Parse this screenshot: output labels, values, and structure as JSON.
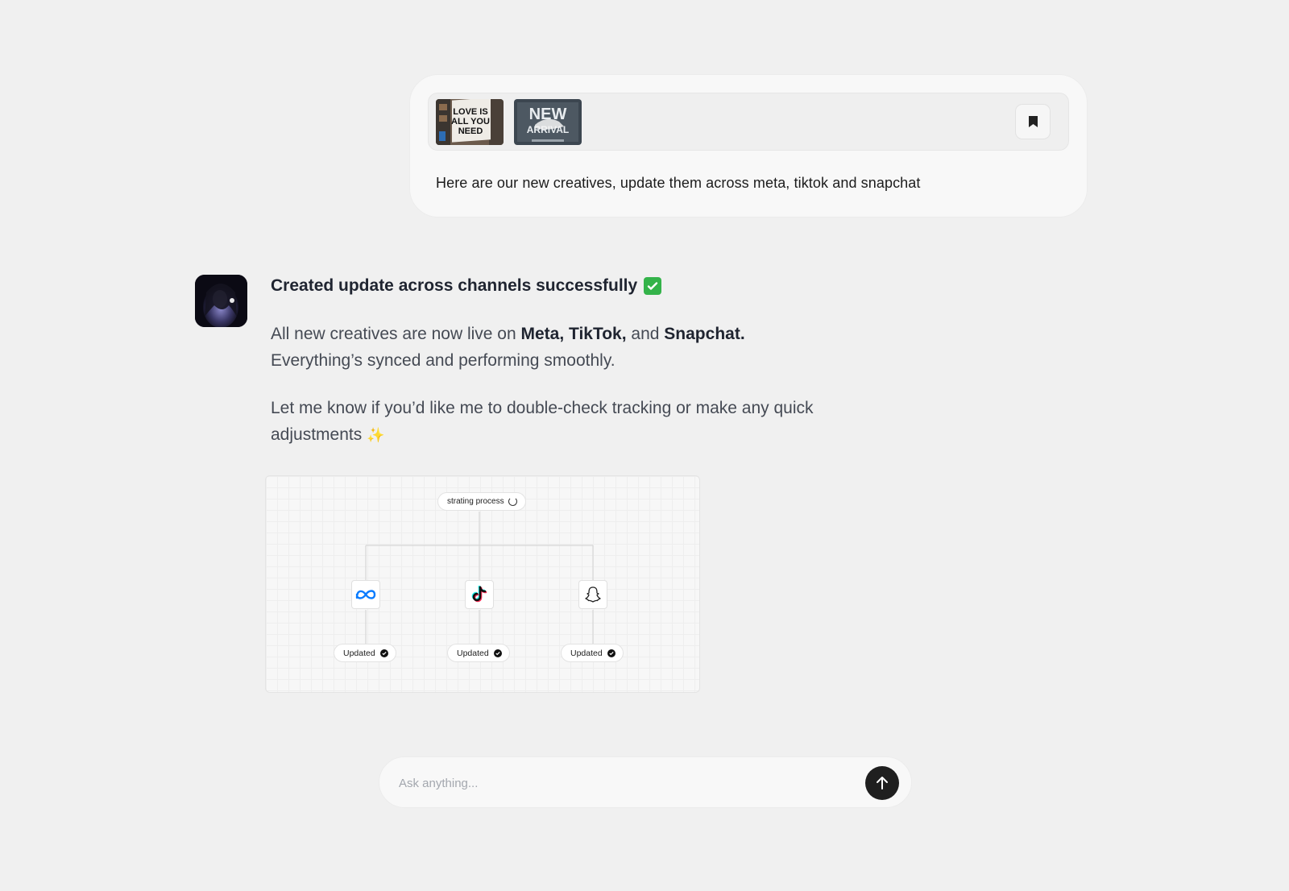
{
  "user_message": {
    "text": "Here are our new creatives, update them across meta, tiktok and snapchat",
    "attachments": [
      {
        "thumb_text": "LOVE IS ALL YOU NEED",
        "lines": [
          "LOVE IS",
          "ALL YOU",
          "NEED"
        ]
      },
      {
        "thumb_text": "NEW ARRIVAL",
        "lines": [
          "NEW",
          "ARRIVAL"
        ]
      }
    ],
    "bookmark_icon": "bookmark-icon"
  },
  "assistant_message": {
    "title": "Created update across channels successfully",
    "title_emoji": "✅",
    "para1": {
      "lead": "All new creatives are now live on ",
      "bold1": "Meta, TikTok,",
      "mid": " and ",
      "bold2": "Snapchat.",
      "line2": "Everything’s synced and performing smoothly."
    },
    "para2": {
      "text": "Let me know if you’d like me to double-check tracking or make any quick adjustments",
      "emoji": "✨"
    }
  },
  "workflow": {
    "start_label": "strating process",
    "channels": [
      {
        "name": "meta-icon",
        "status": "Updated"
      },
      {
        "name": "tiktok-icon",
        "status": "Updated"
      },
      {
        "name": "snapchat-icon",
        "status": "Updated"
      }
    ]
  },
  "composer": {
    "placeholder": "Ask anything...",
    "send_icon": "arrow-up-icon"
  },
  "colors": {
    "background": "#f0f0f0",
    "bubble": "#f8f8f8",
    "send_button": "#1f1f1f",
    "check_green": "#34b34a",
    "meta_blue": "#0a7cff",
    "tiktok_cyan": "#25f4ee",
    "tiktok_red": "#fe2c55"
  }
}
